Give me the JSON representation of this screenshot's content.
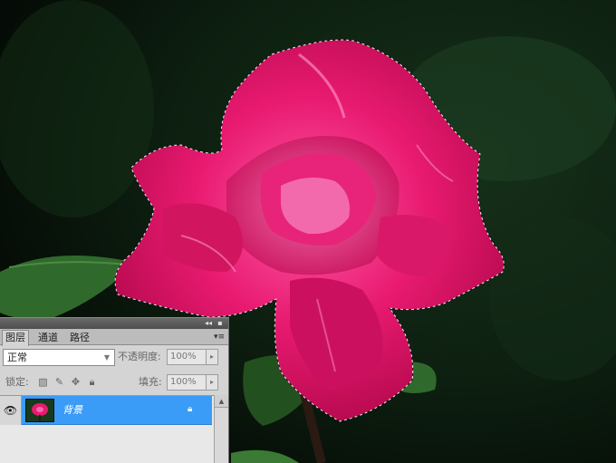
{
  "canvas": {
    "subject": "pink rose photo with marching-ants selection",
    "colors": {
      "background": "#0c1a0e",
      "petal": "#e0186a",
      "petal_light": "#f25aa0",
      "leaf": "#2f5a2a"
    }
  },
  "layers_panel": {
    "titlebar": {
      "collapse_icon": "double-chevron-left-icon",
      "close_icon": "close-icon"
    },
    "tabs": [
      {
        "label": "图层",
        "active": true
      },
      {
        "label": "通道",
        "active": false
      },
      {
        "label": "路径",
        "active": false
      }
    ],
    "menu_icon": "panel-menu-icon",
    "blend_mode": "正常",
    "opacity_label": "不透明度:",
    "opacity_value": "100%",
    "lock_label": "锁定:",
    "fill_label": "填充:",
    "fill_value": "100%",
    "lock_icons": [
      "lock-transparent-icon",
      "lock-image-icon",
      "lock-position-icon",
      "lock-all-icon"
    ],
    "layers": [
      {
        "name": "背景",
        "visible": true,
        "locked": true,
        "selected": true
      }
    ]
  }
}
